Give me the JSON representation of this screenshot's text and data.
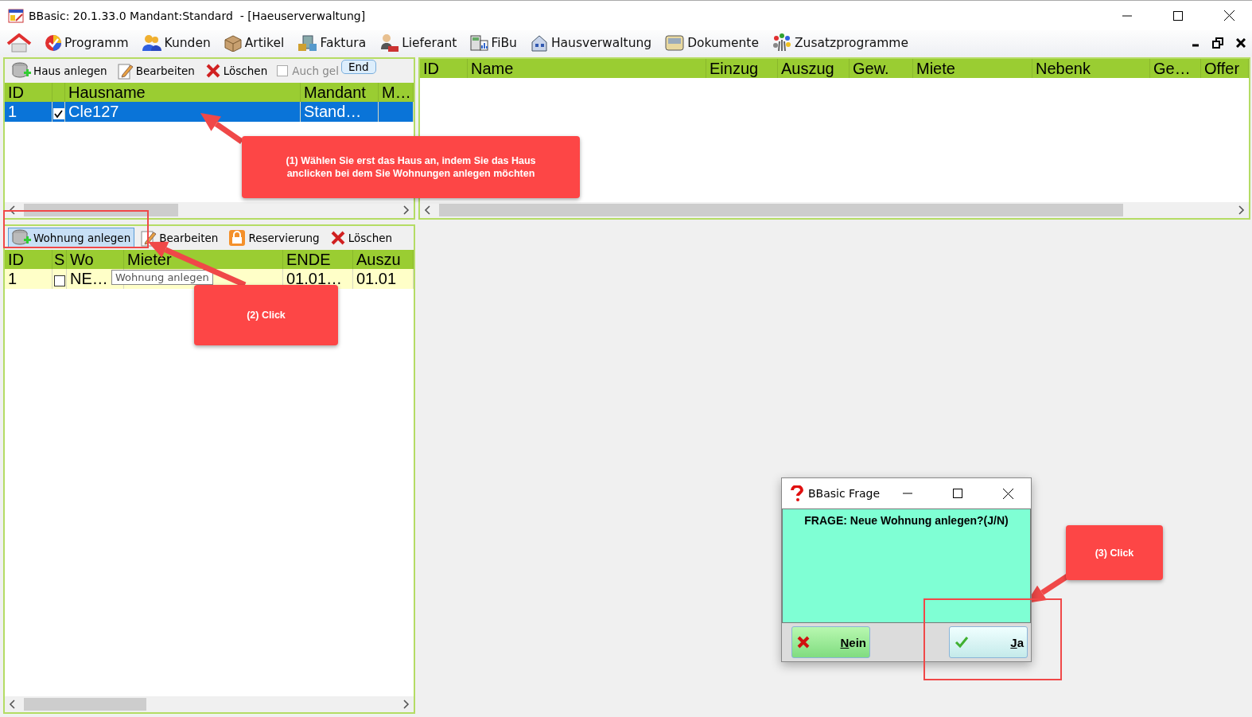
{
  "window": {
    "title": "BBasic: 20.1.33.0 Mandant:Standard  - [Haeuserverwaltung]"
  },
  "menu": [
    {
      "kind": "home"
    },
    {
      "kind": "program",
      "label": "Programm"
    },
    {
      "kind": "people",
      "label": "Kunden"
    },
    {
      "kind": "box",
      "label": "Artikel"
    },
    {
      "kind": "invoice",
      "label": "Faktura"
    },
    {
      "kind": "supplier",
      "label": "Lieferant"
    },
    {
      "kind": "ledger",
      "label": "FiBu"
    },
    {
      "kind": "house",
      "label": "Hausverwaltung"
    },
    {
      "kind": "tray",
      "label": "Dokumente"
    },
    {
      "kind": "extras",
      "label": "Zusatzprogramme"
    }
  ],
  "house_panel": {
    "toolbar": [
      {
        "kind": "add",
        "label": "Haus anlegen"
      },
      {
        "kind": "edit",
        "label": "Bearbeiten"
      },
      {
        "kind": "delete",
        "label": "Löschen"
      }
    ],
    "filter": {
      "label": "Auch gel",
      "checked": false
    },
    "tooltip": "End",
    "columns": [
      {
        "label": "ID"
      },
      {
        "kind": "check"
      },
      {
        "label": "Hausname"
      },
      {
        "label": "Mandant"
      },
      {
        "label": "M…"
      }
    ],
    "rows": [
      {
        "selected": true,
        "cells": [
          {
            "text": "1"
          },
          {
            "checked": true
          },
          {
            "text": "Cle127"
          },
          {
            "text": "Stand…"
          },
          {}
        ]
      }
    ]
  },
  "apartment_panel": {
    "toolbar": [
      {
        "kind": "add",
        "label": "Wohnung anlegen",
        "selected": true
      },
      {
        "kind": "edit",
        "label": "Bearbeiten",
        "selected": false
      },
      {
        "kind": "lock",
        "label": "Reservierung",
        "selected": false
      },
      {
        "kind": "delete",
        "label": "Löschen",
        "selected": false
      }
    ],
    "tooltip": "Wohnung anlegen",
    "columns": [
      {
        "label": "ID"
      },
      {
        "kind": "check",
        "label": "S"
      },
      {
        "label": "Wo"
      },
      {
        "label": "Mieter"
      },
      {
        "label": "ENDE"
      },
      {
        "label": "Auszu"
      }
    ],
    "rows": [
      {
        "selected": false,
        "cells": [
          {
            "text": "1"
          },
          {
            "checked": false
          },
          {
            "text": "NE…"
          },
          {},
          {
            "text": "01.01…"
          },
          {
            "text": "01.01"
          }
        ]
      }
    ]
  },
  "tenant_table": {
    "columns": [
      {
        "label": "ID"
      },
      {
        "label": "Name"
      },
      {
        "label": "Einzug"
      },
      {
        "label": "Auszug"
      },
      {
        "label": "Gew."
      },
      {
        "label": "Miete"
      },
      {
        "label": "Nebenk"
      },
      {
        "label": "Ge…"
      },
      {
        "label": "Offer"
      }
    ]
  },
  "dialog": {
    "title": "BBasic Frage",
    "message": "FRAGE: Neue Wohnung anlegen?(J/N)",
    "buttons": [
      {
        "kind": "no",
        "label": "Nein"
      },
      {
        "kind": "yes",
        "label": "Ja"
      }
    ]
  },
  "callouts": [
    {
      "text": "(1) Wählen Sie erst das Haus an, indem Sie das Haus anclicken bei dem Sie Wohnungen anlegen möchten"
    },
    {
      "text": "(2) Click"
    },
    {
      "text": "(3) Click"
    }
  ]
}
